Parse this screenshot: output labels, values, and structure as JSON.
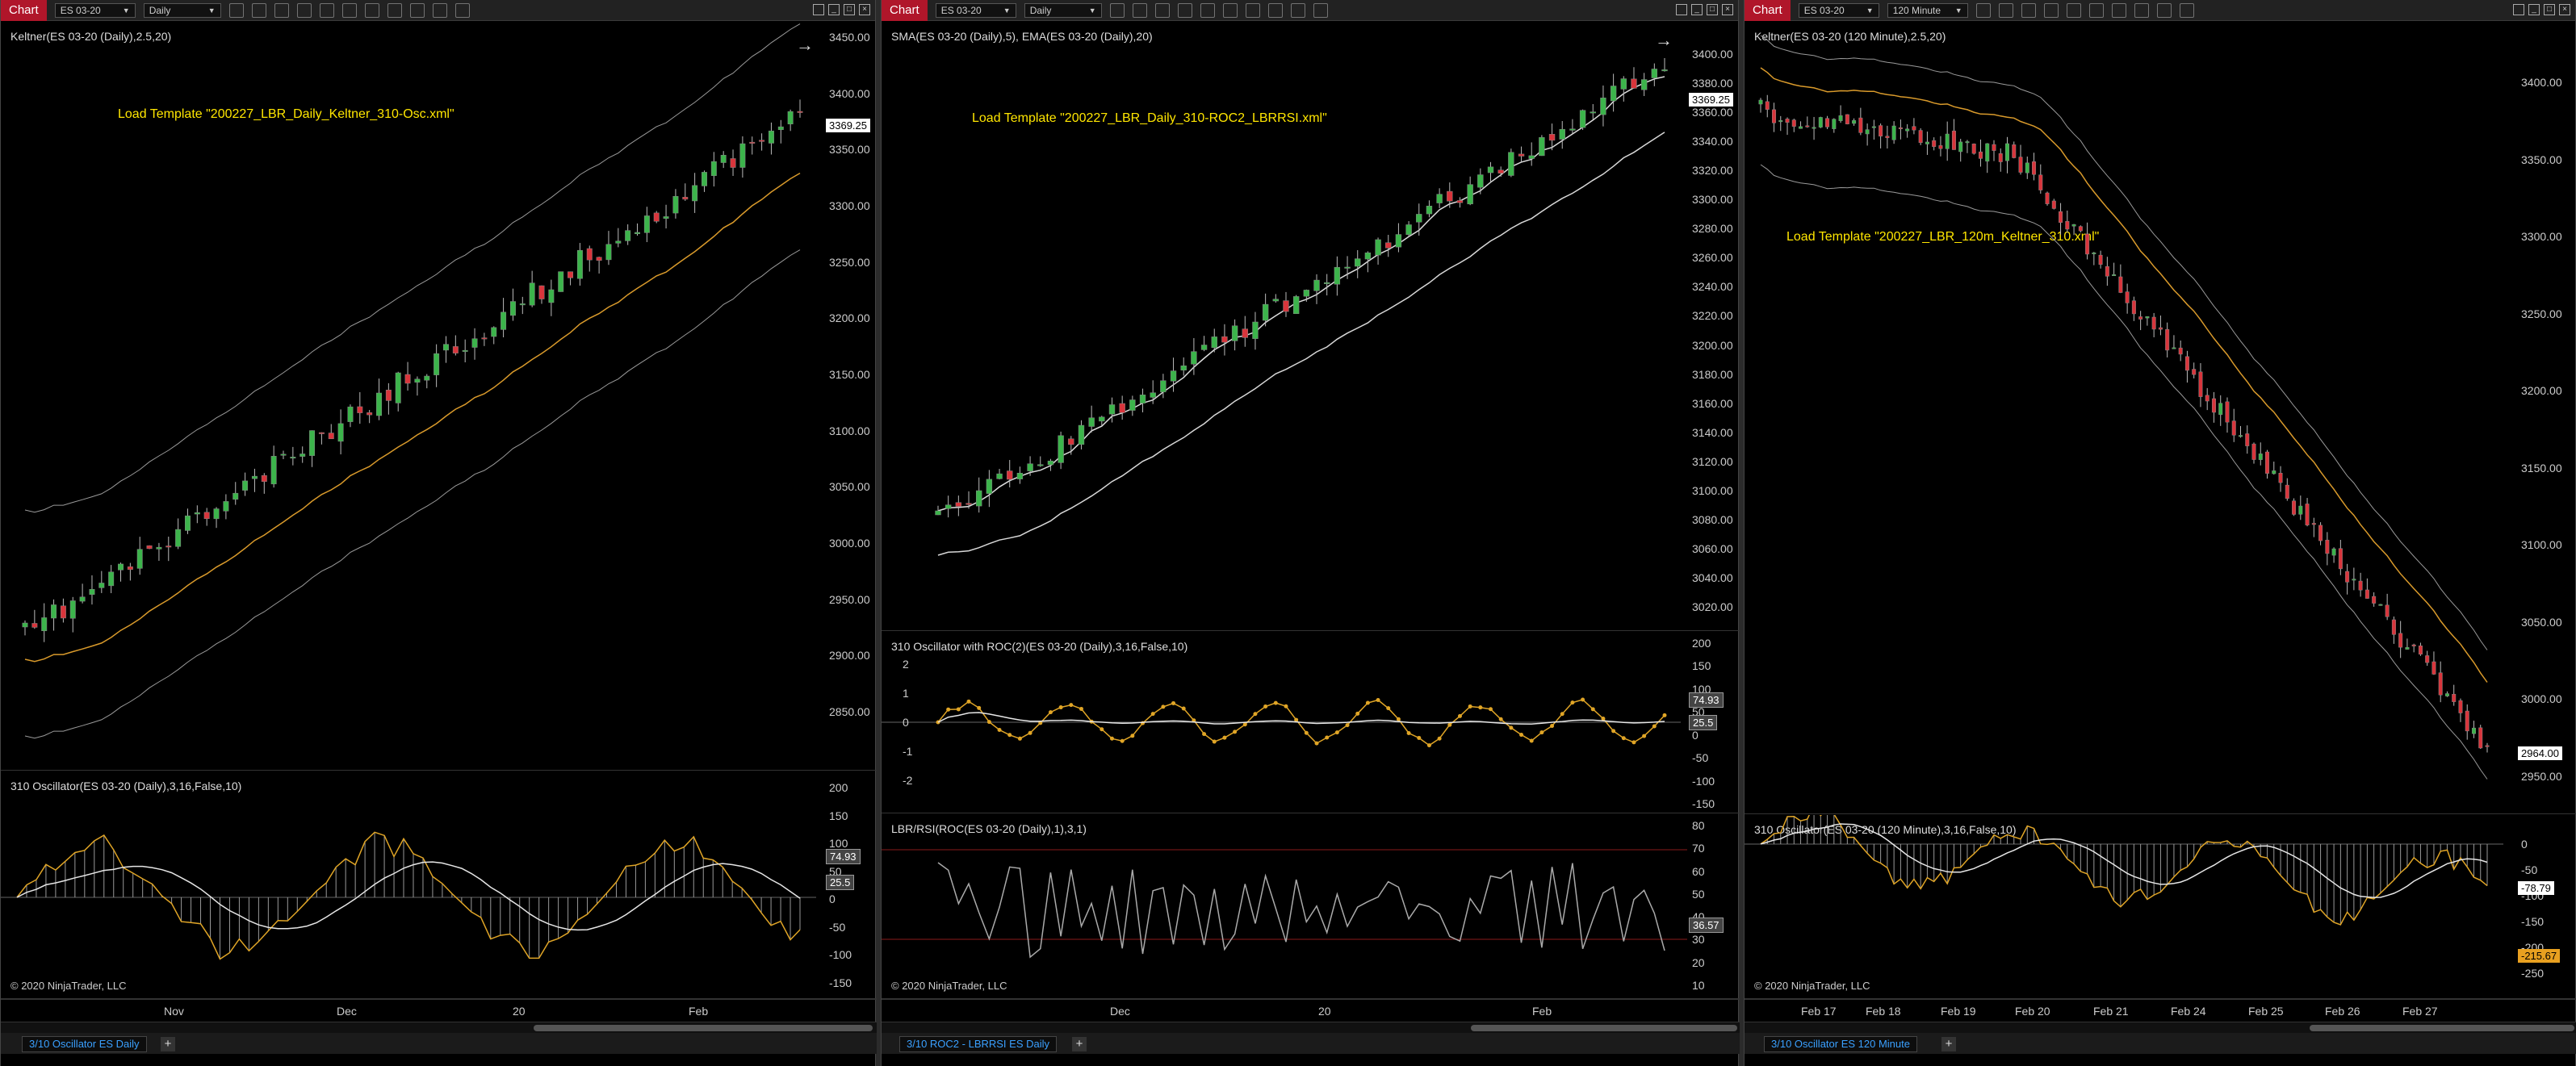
{
  "windows": [
    {
      "chart_button": "Chart",
      "instrument": "ES 03-20",
      "interval": "Daily",
      "price_label": "Keltner(ES 03-20 (Daily),2.5,20)",
      "template_text": "Load Template \"200227_LBR_Daily_Keltner_310-Osc.xml\"",
      "price_axis": [
        "3450.00",
        "3400.00",
        "3350.00",
        "3300.00",
        "3250.00",
        "3200.00",
        "3150.00",
        "3100.00",
        "3050.00",
        "3000.00",
        "2950.00",
        "2900.00",
        "2850.00"
      ],
      "price_badge": "3369.25",
      "osc_label": "310 Oscillator(ES 03-20 (Daily),3,16,False,10)",
      "osc_axis": [
        "200",
        "150",
        "100",
        "50",
        "0",
        "-50",
        "-100",
        "-150"
      ],
      "osc_badges": [
        "74.93",
        "25.5"
      ],
      "copyright": "© 2020 NinjaTrader, LLC",
      "x_labels": [
        "Nov",
        "Dec",
        "20",
        "Feb"
      ],
      "tab": "3/10 Oscillator ES Daily"
    },
    {
      "chart_button": "Chart",
      "instrument": "ES 03-20",
      "interval": "Daily",
      "price_label": "SMA(ES 03-20 (Daily),5), EMA(ES 03-20 (Daily),20)",
      "template_text": "Load Template \"200227_LBR_Daily_310-ROC2_LBRRSI.xml\"",
      "price_axis": [
        "3400.00",
        "3380.00",
        "3360.00",
        "3340.00",
        "3320.00",
        "3300.00",
        "3280.00",
        "3260.00",
        "3240.00",
        "3220.00",
        "3200.00",
        "3180.00",
        "3160.00",
        "3140.00",
        "3120.00",
        "3100.00",
        "3080.00",
        "3060.00",
        "3040.00",
        "3020.00"
      ],
      "price_badge": "3369.25",
      "osc_label": "310 Oscillator with ROC(2)(ES 03-20 (Daily),3,16,False,10)",
      "osc_axis": [
        "200",
        "150",
        "100",
        "50",
        "0",
        "-50",
        "-100",
        "-150"
      ],
      "osc_left_axis": [
        "2",
        "1",
        "0",
        "-1",
        "-2"
      ],
      "osc_badges": [
        "74.93",
        "25.5"
      ],
      "rsi_label": "LBR/RSI(ROC(ES 03-20 (Daily),1),3,1)",
      "rsi_axis": [
        "80",
        "70",
        "60",
        "50",
        "40",
        "30",
        "20",
        "10"
      ],
      "rsi_badge": "36.57",
      "copyright": "© 2020 NinjaTrader, LLC",
      "x_labels": [
        "Dec",
        "20",
        "Feb"
      ],
      "tab": "3/10 ROC2 - LBRRSI ES Daily"
    },
    {
      "chart_button": "Chart",
      "instrument": "ES 03-20",
      "interval": "120 Minute",
      "price_label": "Keltner(ES 03-20 (120 Minute),2.5,20)",
      "template_text": "Load Template \"200227_LBR_120m_Keltner_310.xml\"",
      "price_axis": [
        "3400.00",
        "3350.00",
        "3300.00",
        "3250.00",
        "3200.00",
        "3150.00",
        "3100.00",
        "3050.00",
        "3000.00",
        "2950.00"
      ],
      "price_badge": "2964.00",
      "osc_label": "310 Oscillator(ES 03-20 (120 Minute),3,16,False,10)",
      "osc_axis": [
        "0",
        "-50",
        "-100",
        "-150",
        "-200",
        "-250"
      ],
      "osc_badges": [
        "-78.79",
        "-215.67"
      ],
      "copyright": "© 2020 NinjaTrader, LLC",
      "x_labels": [
        "Feb 17",
        "Feb 18",
        "Feb 19",
        "Feb 20",
        "Feb 21",
        "Feb 24",
        "Feb 25",
        "Feb 26",
        "Feb 27"
      ],
      "tab": "3/10 Oscillator ES 120 Minute"
    }
  ],
  "colors": {
    "up_candle": "#3cb44b",
    "down_candle": "#d9353c",
    "keltner_mid": "#d99a2b",
    "band": "#9a9a9a",
    "osc_line": "#e0a526",
    "template_text": "#ffe600"
  }
}
